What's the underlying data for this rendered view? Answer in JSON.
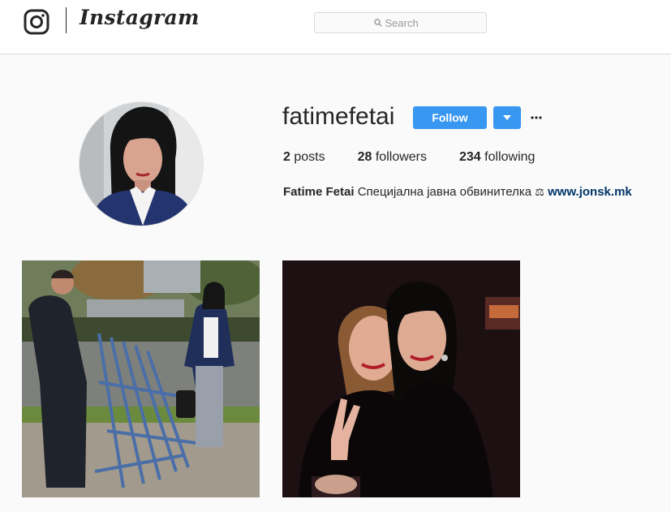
{
  "header": {
    "brand": "Instagram",
    "search": {
      "placeholder": "Search",
      "value": ""
    }
  },
  "profile": {
    "username": "fatimefetai",
    "follow_label": "Follow",
    "stats": {
      "posts_count": "2",
      "posts_label": "posts",
      "followers_count": "28",
      "followers_label": "followers",
      "following_count": "234",
      "following_label": "following"
    },
    "bio": {
      "full_name": "Fatime Fetai",
      "text": "Специјална јавна обвинителка",
      "emoji": "⚖",
      "link": "www.jonsk.mk"
    }
  },
  "posts": [
    {
      "icon": "photo-street-scene"
    },
    {
      "icon": "photo-night-selfie"
    }
  ],
  "colors": {
    "accent": "#3897f0",
    "link": "#003569",
    "background": "#fafafa",
    "text": "#262626"
  }
}
